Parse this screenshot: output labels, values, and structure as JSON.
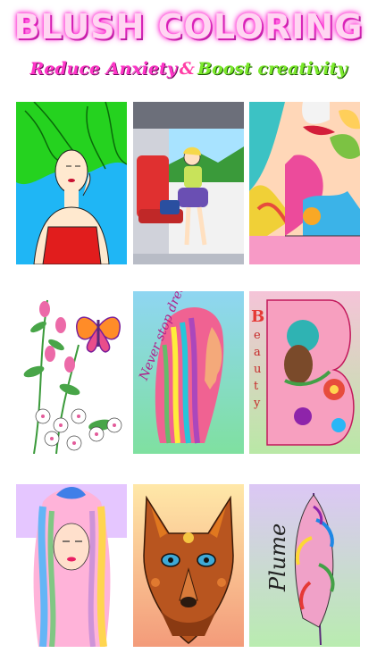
{
  "header": {
    "title": "BLUSH COLORING",
    "tagline_part1": "Reduce Anxiety",
    "tagline_amp": "&",
    "tagline_part2": "Boost creativity"
  },
  "cards": {
    "card2_note": "",
    "card5_text": "Never stop dreaming",
    "card6_letter": "B",
    "card6_text": "eauty",
    "card9_text": "Plume"
  },
  "colors": {
    "title_glow": "#ff2bd3",
    "tagline_pink": "#ff35c8",
    "tagline_green": "#7bea2b"
  }
}
